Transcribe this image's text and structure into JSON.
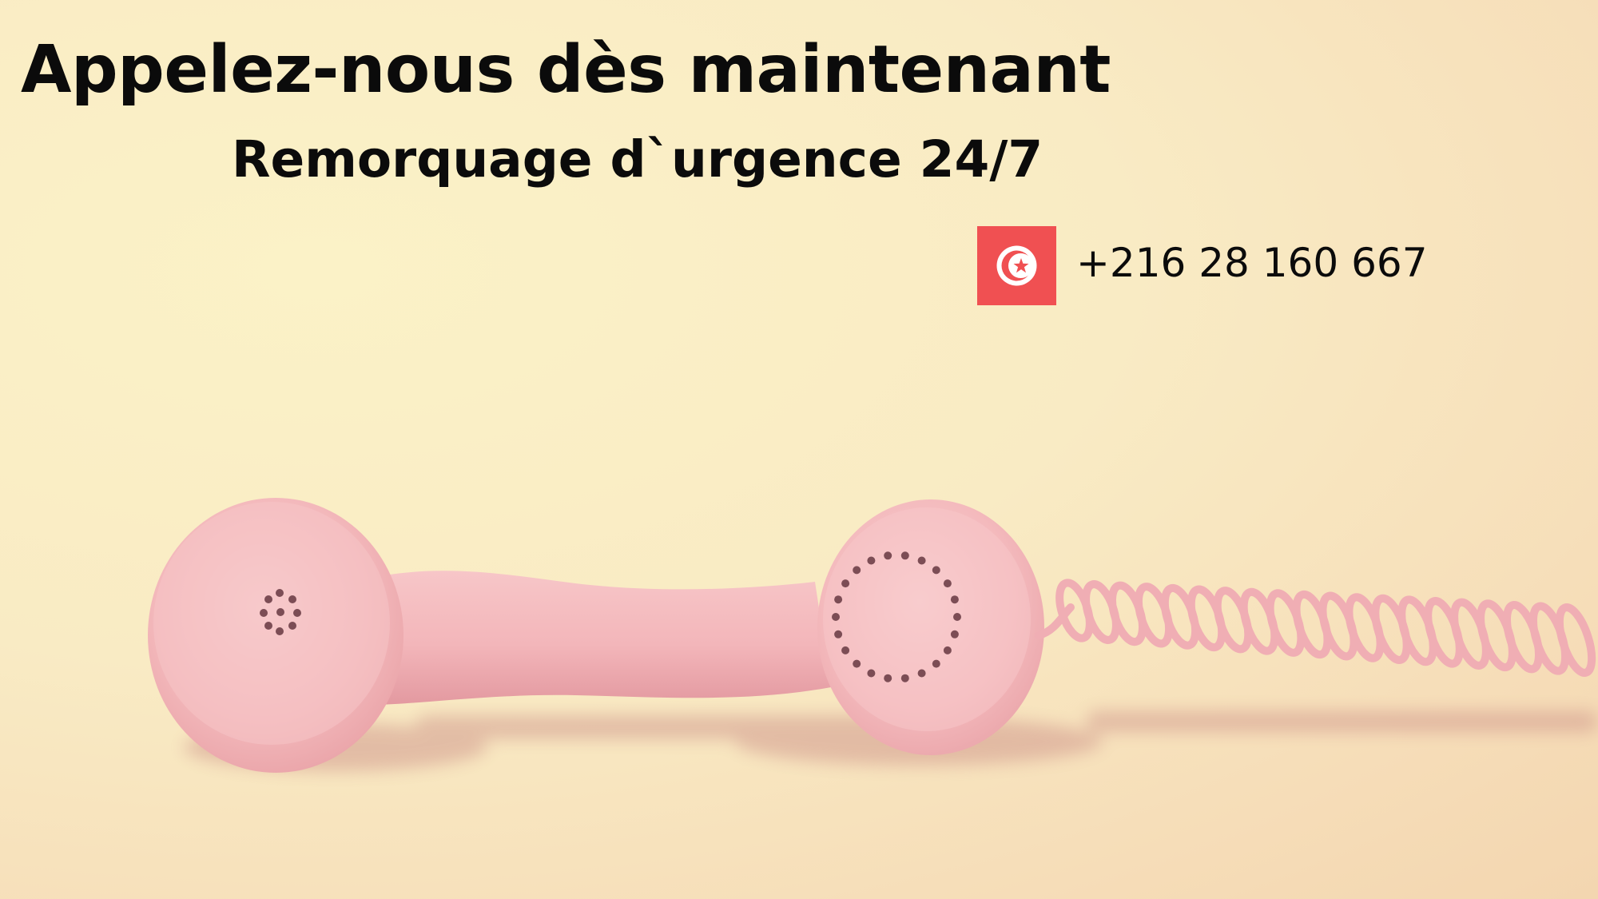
{
  "headline": "Appelez-nous dès maintenant",
  "subheadline": "Remorquage d`urgence 24/7",
  "contact": {
    "phone": "+216 28 160 667",
    "flag_icon": "tunisia-flag-icon"
  },
  "colors": {
    "background": "#f9ebc4",
    "flag_red": "#f05052",
    "handset_pink": "#f3b9bd",
    "text": "#0b0b0b"
  },
  "image_subject": "pink-telephone-handset"
}
